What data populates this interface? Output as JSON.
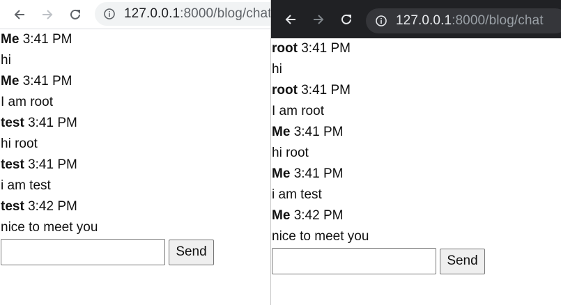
{
  "left_window": {
    "url_host": "127.0.0.1",
    "url_rest": ":8000/blog/chat",
    "messages": [
      {
        "sender": "Me",
        "time": "3:41 PM",
        "text": "hi"
      },
      {
        "sender": "Me",
        "time": "3:41 PM",
        "text": "I am root"
      },
      {
        "sender": "test",
        "time": "3:41 PM",
        "text": "hi root"
      },
      {
        "sender": "test",
        "time": "3:41 PM",
        "text": "i am test"
      },
      {
        "sender": "test",
        "time": "3:42 PM",
        "text": "nice to meet you"
      }
    ],
    "input_value": "",
    "send_label": "Send"
  },
  "right_window": {
    "url_host": "127.0.0.1",
    "url_rest": ":8000/blog/chat",
    "messages": [
      {
        "sender": "root",
        "time": "3:41 PM",
        "text": "hi"
      },
      {
        "sender": "root",
        "time": "3:41 PM",
        "text": "I am root"
      },
      {
        "sender": "Me",
        "time": "3:41 PM",
        "text": "hi root"
      },
      {
        "sender": "Me",
        "time": "3:41 PM",
        "text": "i am test"
      },
      {
        "sender": "Me",
        "time": "3:42 PM",
        "text": "nice to meet you"
      }
    ],
    "input_value": "",
    "send_label": "Send"
  },
  "icons": [
    "back-icon",
    "forward-icon",
    "reload-icon",
    "info-icon"
  ],
  "colors": {
    "left_toolbar": "#ffffff",
    "left_omnibox": "#f1f3f4",
    "right_toolbar": "#202124",
    "right_omnibox": "#35363a"
  }
}
